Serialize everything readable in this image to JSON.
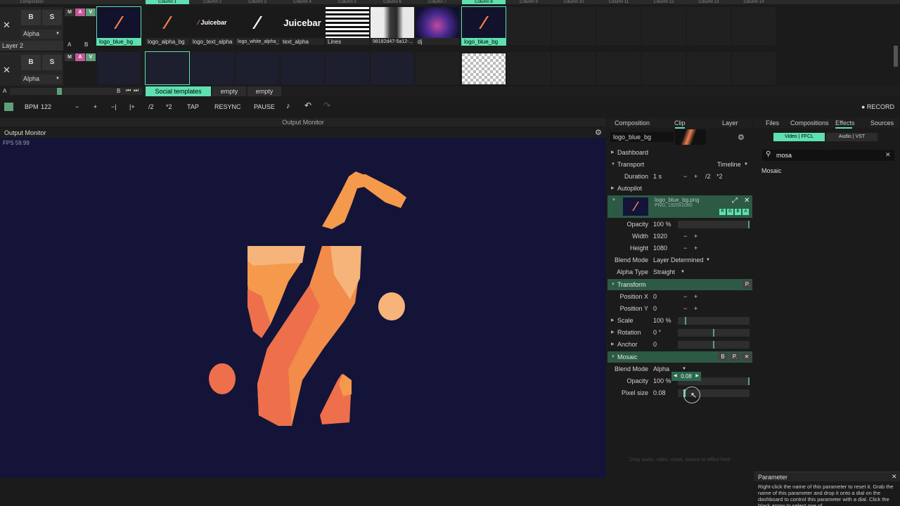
{
  "columns": [
    "Composition",
    "Column 1",
    "Column 2",
    "Column 3",
    "Column 4",
    "Column 5",
    "Column 6",
    "Column 7",
    "Column 8",
    "Column 9",
    "Column 10",
    "Column 11",
    "Column 12",
    "Column 13",
    "Column 14"
  ],
  "layer2": {
    "name": "Layer 2",
    "b": "B",
    "s": "S",
    "blend": "Alpha",
    "m": "M",
    "a": "A",
    "v": "V",
    "ab_a": "A",
    "ab_b": "B"
  },
  "layer1": {
    "b": "B",
    "s": "S",
    "blend": "Alpha",
    "m": "M",
    "a": "A",
    "v": "V"
  },
  "clips": [
    {
      "label": "logo_blue_bg",
      "kind": "logo",
      "selected": true
    },
    {
      "label": "logo_alpha_bg",
      "kind": "logo",
      "selected": false
    },
    {
      "label": "logo_text_alpha",
      "kind": "text",
      "text": "Juicebar",
      "selected": false
    },
    {
      "label": "logo_white_alpha_bg",
      "kind": "white",
      "selected": false
    },
    {
      "label": "text_alpha",
      "kind": "bigtext",
      "text": "Juicebar",
      "selected": false
    },
    {
      "label": "Lines",
      "kind": "lines",
      "selected": false
    },
    {
      "label": "98182d47-5a12-...",
      "kind": "person",
      "selected": false
    },
    {
      "label": "dj",
      "kind": "dj",
      "selected": false
    },
    {
      "label": "logo_blue_bg",
      "kind": "logo",
      "selected": true
    }
  ],
  "deck": {
    "a": "A",
    "b": "B",
    "tabs": [
      "Social templates",
      "empty",
      "empty"
    ]
  },
  "transport": {
    "bpm_label": "BPM",
    "bpm": "122",
    "minus": "−",
    "plus": "+",
    "nudge_minus": "−|",
    "nudge_plus": "|+",
    "half": "/2",
    "double": "*2",
    "tap": "TAP",
    "resync": "RESYNC",
    "pause": "PAUSE",
    "record": "● RECORD"
  },
  "output": {
    "title": "Output Monitor",
    "label": "Output Monitor",
    "fps": "FPS 59.99"
  },
  "tabs_mid": [
    "Composition",
    "Clip",
    "Layer"
  ],
  "tabs_right": [
    "Files",
    "Compositions",
    "Effects",
    "Sources"
  ],
  "clip": {
    "name": "logo_blue_bg",
    "dashboard": "Dashboard",
    "transport": "Transport",
    "timeline": "Timeline",
    "duration_label": "Duration",
    "duration": "1 s",
    "dur_minus": "−",
    "dur_plus": "+",
    "dur_half": "/2",
    "dur_double": "*2",
    "autopilot": "Autopilot",
    "file": "logo_blue_bg.png",
    "file_info": "PNG, 1920x1080",
    "rgba": [
      "R",
      "G",
      "B",
      "A"
    ]
  },
  "params": {
    "opacity_label": "Opacity",
    "opacity": "100 %",
    "width_label": "Width",
    "width": "1920",
    "height_label": "Height",
    "height": "1080",
    "blend_label": "Blend Mode",
    "blend": "Layer Determined",
    "alpha_label": "Alpha Type",
    "alpha": "Straight"
  },
  "transform": {
    "title": "Transform",
    "p": "P.",
    "posx_label": "Position X",
    "posx": "0",
    "posy_label": "Position Y",
    "posy": "0",
    "scale_label": "Scale",
    "scale": "100 %",
    "rotation_label": "Rotation",
    "rotation": "0 °",
    "anchor_label": "Anchor",
    "anchor": "0"
  },
  "mosaic": {
    "title": "Mosaic",
    "b": "B",
    "p": "P.",
    "blend_label": "Blend Mode",
    "blend": "Alpha",
    "opacity_label": "Opacity",
    "opacity": "100 %",
    "pixel_label": "Pixel size",
    "pixel": "0.08",
    "tooltip": "0.08",
    "pixel_frac": 0.08
  },
  "drop_hint": "Drop audio, video, mask, source or effect here",
  "effects": {
    "video": "Video | FFCL",
    "audio": "Audio | VST",
    "search": "mosa",
    "result": "Mosaic"
  },
  "help": {
    "title": "Parameter",
    "text": "Right-click the name of this parameter to reset it. Grab the name of this parameter and drop it onto a dial on the dashboard to control this parameter with a dial. Click the black arrow to select one of"
  },
  "colors": {
    "accent": "#5fe0b0",
    "canvas": "#141438",
    "green_header": "#2c5a44"
  }
}
